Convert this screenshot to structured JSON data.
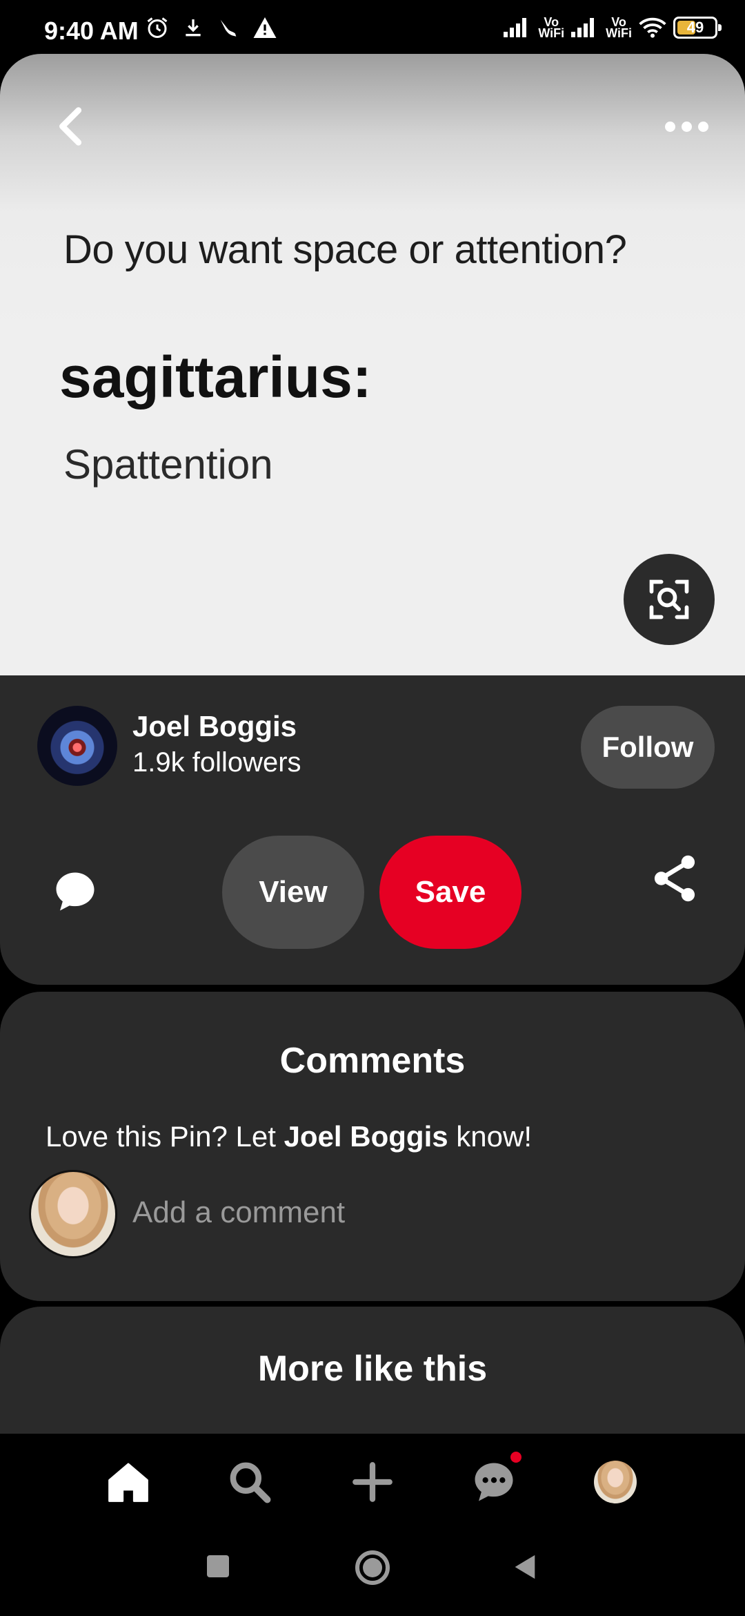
{
  "status_bar": {
    "time": "9:40 AM",
    "left_icons": [
      "alarm-icon",
      "download-icon",
      "bird-icon",
      "warning-icon"
    ],
    "right_icons": [
      "signal-icon",
      "vowifi-icon",
      "signal-icon",
      "vowifi-icon",
      "wifi-icon",
      "battery-icon"
    ],
    "volte_label": "Vo\nWiFi",
    "battery_level": "49",
    "battery_color": "#e8b53b"
  },
  "pin": {
    "question": "Do you want space or attention?",
    "sign": "sagittarius:",
    "answer": "Spattention"
  },
  "creator": {
    "name": "Joel Boggis",
    "followers": "1.9k followers",
    "follow_label": "Follow"
  },
  "actions": {
    "view_label": "View",
    "save_label": "Save",
    "save_color": "#e60023"
  },
  "comments": {
    "title": "Comments",
    "prompt_before": "Love this Pin? Let ",
    "prompt_name": "Joel Boggis",
    "prompt_after": " know!",
    "input_placeholder": "Add a comment"
  },
  "more": {
    "title": "More like this"
  },
  "bottom_nav": {
    "items": [
      "home-icon",
      "search-icon",
      "plus-icon",
      "messages-icon",
      "profile-avatar"
    ],
    "notification_color": "#e60023"
  },
  "system_nav": [
    "recents-icon",
    "home-circle-icon",
    "back-triangle-icon"
  ]
}
